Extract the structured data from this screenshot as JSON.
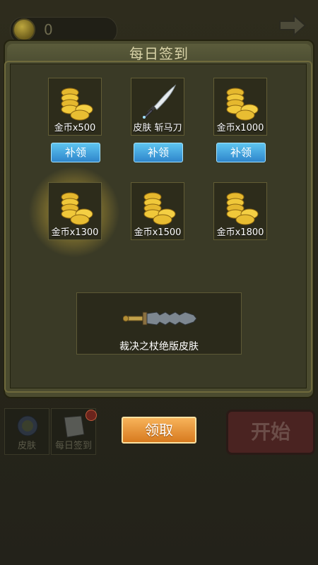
{
  "topbar": {
    "coin_count": "0",
    "arrow_icon": "arrow-right-icon"
  },
  "panel": {
    "title": "每日签到"
  },
  "rewards": [
    {
      "label": "金币x500",
      "icon": "coins-icon",
      "action": "补领"
    },
    {
      "label": "皮肤 斩马刀",
      "icon": "sword-icon",
      "action": "补领"
    },
    {
      "label": "金币x1000",
      "icon": "coins-icon",
      "action": "补领"
    },
    {
      "label": "金币x1300",
      "icon": "coins-icon"
    },
    {
      "label": "金币x1500",
      "icon": "coins-icon"
    },
    {
      "label": "金币x1800",
      "icon": "coins-icon"
    }
  ],
  "grand_reward": {
    "label": "裁决之杖绝版皮肤",
    "icon": "dagger-icon"
  },
  "bottom": {
    "skin_label": "皮肤",
    "checkin_label": "每日签到",
    "claim_label": "领取",
    "start_label": "开始"
  },
  "colors": {
    "accent_blue": "#3a98dc",
    "claim_orange": "#e48c2c",
    "panel": "#4b4b2f"
  }
}
